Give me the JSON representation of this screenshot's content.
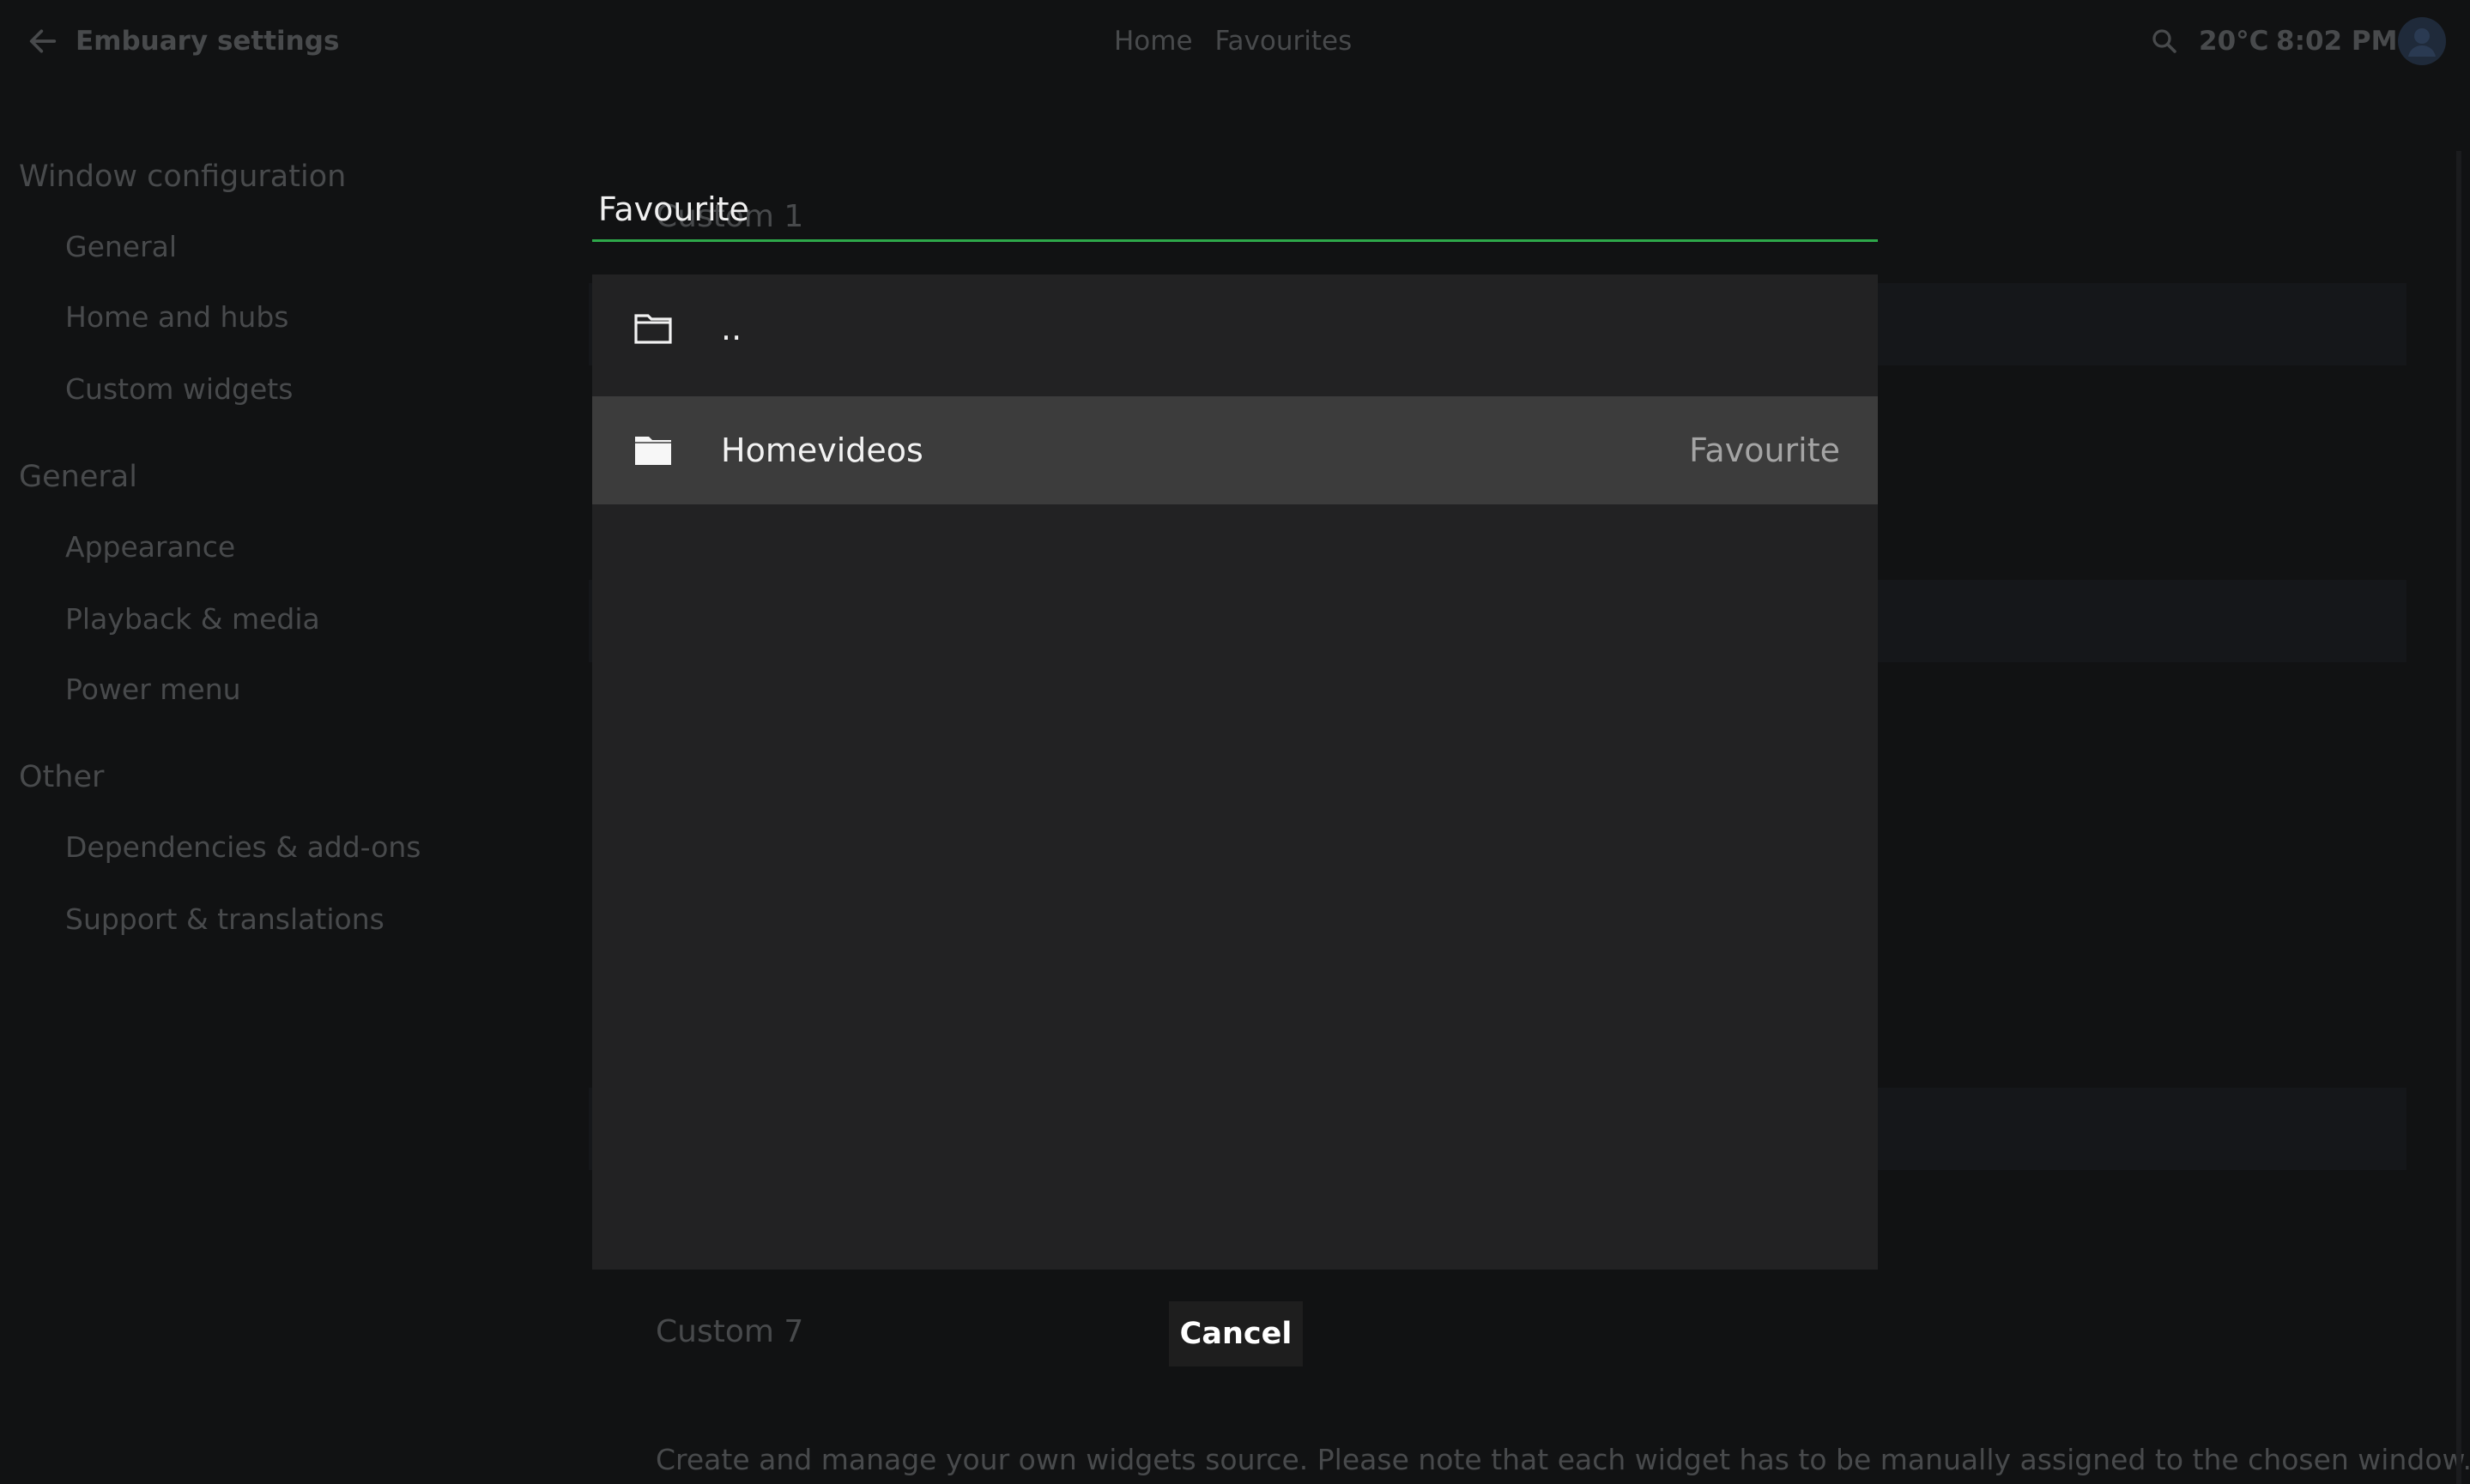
{
  "header": {
    "title": "Embuary settings",
    "breadcrumb": [
      "Home",
      "Favourites"
    ],
    "weather": "20°C",
    "clock": "8:02 PM"
  },
  "sidebar": {
    "sections": [
      {
        "title": "Window configuration",
        "items": [
          "General",
          "Home and hubs",
          "Custom widgets"
        ]
      },
      {
        "title": "General",
        "items": [
          "Appearance",
          "Playback & media",
          "Power menu"
        ]
      },
      {
        "title": "Other",
        "items": [
          "Dependencies & add-ons",
          "Support & translations"
        ]
      }
    ]
  },
  "background": {
    "first_item": "Custom 1",
    "last_item": "Custom 7",
    "footer_text": "Create and manage your own widgets source. Please note that each widget has to be manually assigned to the chosen window."
  },
  "dialog": {
    "heading": "Favourite",
    "rows": [
      {
        "label": "..",
        "value": "",
        "icon": "folder-outline-icon"
      },
      {
        "label": "Homevideos",
        "value": "Favourite",
        "icon": "folder-icon"
      }
    ],
    "cancel_label": "Cancel",
    "accent_color": "#2ea84a"
  }
}
